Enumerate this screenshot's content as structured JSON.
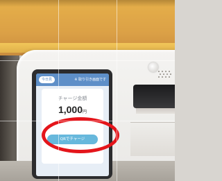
{
  "screen": {
    "back_label": "今日見",
    "help_label": "※ 取り引き画面です",
    "charge_label": "チャージ金額",
    "amount": "1,000",
    "amount_unit": "円",
    "qr_button_label": "QRでチャージ"
  },
  "annotation": {
    "highlight_color": "#e4151b",
    "highlight_shape": "oval"
  },
  "colors": {
    "screen_header": "#5e8fc8",
    "qr_button": "#67b8dc"
  }
}
